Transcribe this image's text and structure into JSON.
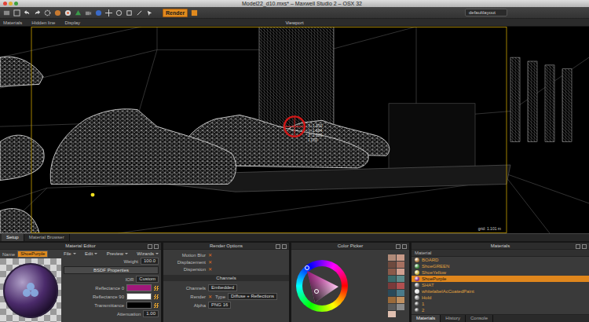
{
  "window": {
    "title": "Model22_d10.mxs* – Maxwell Studio 2 – OSX 32"
  },
  "toolbar": {
    "render_button": "Render",
    "layout": "defaultlayout"
  },
  "subbar": {
    "labels": [
      "Materials",
      "Hidden line",
      "Display"
    ],
    "viewport_title": "Viewport"
  },
  "viewport": {
    "readouts": [
      "X: 1.950",
      "Y: 1.684",
      "Z: 2.000",
      "1.050"
    ],
    "grid": "grid: 1.101 m"
  },
  "viewport_tabs": [
    {
      "label": "Setup",
      "selected": true
    },
    {
      "label": "Material Browser",
      "selected": false
    }
  ],
  "material_editor": {
    "title": "Material Editor",
    "name_label": "Name",
    "name": "ShoePurple",
    "menus": [
      "File",
      "Edit",
      "Preview",
      "Wizards"
    ],
    "weight_label": "Weight",
    "weight": "100.0",
    "section": "BSDF Properties",
    "ior_label": "IOR",
    "ior": "Custom",
    "properties": [
      {
        "label": "Reflectance 0",
        "color": "#a0187a"
      },
      {
        "label": "Reflectance 90",
        "color": "#ffffff"
      },
      {
        "label": "Transmittance",
        "color": "#000000"
      }
    ],
    "attenuation_label": "Attenuation",
    "attenuation": "1.00"
  },
  "render_options": {
    "title": "Render Options",
    "check_glyph": "✕",
    "toggles": [
      {
        "label": "Motion Blur",
        "checked": true
      },
      {
        "label": "Displacement",
        "checked": true
      },
      {
        "label": "Dispersion",
        "checked": true
      }
    ],
    "channels_title": "Channels",
    "channels_label": "Channels",
    "channels": "Embedded",
    "render_label": "Render",
    "render_checked": true,
    "type_label": "Type",
    "type": "Diffuse + Reflections",
    "alpha_label": "Alpha",
    "alpha": "PNG 16"
  },
  "color_picker": {
    "title": "Color Picker",
    "color": "#d61fa8",
    "swatches": [
      {
        "color": "#b08a78"
      },
      {
        "color": "#c89a88"
      },
      {
        "color": "#6e4a3e"
      },
      {
        "color": "#a67060"
      },
      {
        "color": "#8a5a4a"
      },
      {
        "color": "#d0a090"
      },
      {
        "color": "#3a6a6a"
      },
      {
        "color": "#5a8a8a"
      },
      {
        "color": "#7a3a3a"
      },
      {
        "color": "#b05050"
      },
      {
        "color": "#2a4a5a"
      },
      {
        "color": "#4a7a8a"
      },
      {
        "color": "#9a6a3a"
      },
      {
        "color": "#c09060"
      },
      {
        "color": "#5a5a5a"
      },
      {
        "color": "#8a8a8a"
      },
      {
        "color": "#e0c0b0"
      },
      {
        "color": "#3a3a3a"
      }
    ]
  },
  "materials": {
    "title": "Materials",
    "header": "Material",
    "items": [
      {
        "name": "BOARD",
        "selected": false,
        "color": "#b07a3a"
      },
      {
        "name": "ShoeGREEN",
        "selected": false,
        "color": "#3a8a3a"
      },
      {
        "name": "ShoeYellow",
        "selected": false,
        "color": "#c9b23a"
      },
      {
        "name": "ShoePurple",
        "selected": true,
        "color": "#8a2a8a"
      },
      {
        "name": "SHAT",
        "selected": false,
        "color": "#777777"
      },
      {
        "name": "whitelabelAcCoatedPaint",
        "selected": false,
        "color": "#dddddd"
      },
      {
        "name": "Hold",
        "selected": false,
        "color": "#888888"
      },
      {
        "name": "1",
        "selected": false,
        "color": "#444444"
      },
      {
        "name": "2",
        "selected": false,
        "color": "#444444"
      }
    ],
    "tabs": [
      {
        "label": "Materials",
        "selected": true
      },
      {
        "label": "History",
        "selected": false
      },
      {
        "label": "Console",
        "selected": false
      }
    ]
  }
}
